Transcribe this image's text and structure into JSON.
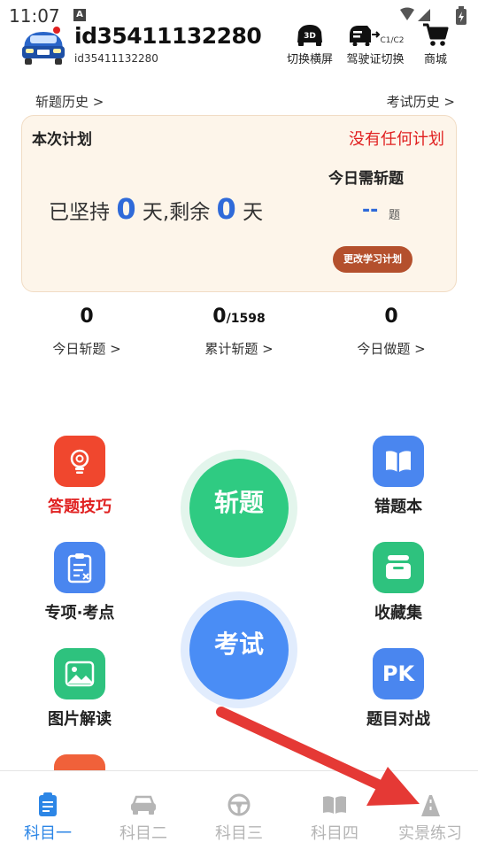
{
  "status_bar": {
    "time": "11:07",
    "badge": "A"
  },
  "user": {
    "name": "id35411132280",
    "id": "id35411132280"
  },
  "header_buttons": [
    {
      "label": "切换横屏",
      "icon": "car-3d-icon",
      "icon_text": "3D"
    },
    {
      "label": "驾驶证切换",
      "icon": "license-switch-icon",
      "icon_text": "C1/C2"
    },
    {
      "label": "商城",
      "icon": "cart-icon"
    }
  ],
  "history": {
    "left": "斩题历史 >",
    "right": "考试历史 >"
  },
  "plan": {
    "title": "本次计划",
    "status": "没有任何计划",
    "persist_prefix": "已坚持",
    "persist_days": "0",
    "persist_mid": "天,剩余",
    "remain_days": "0",
    "persist_suffix": "天",
    "need_label": "今日需斩题",
    "need_value": "--",
    "need_unit": "题",
    "change_button": "更改学习计划"
  },
  "stats": [
    {
      "value": "0",
      "suffix": "",
      "label": "今日斩题 >"
    },
    {
      "value": "0",
      "suffix": "/1598",
      "label": "累计斩题 >"
    },
    {
      "value": "0",
      "suffix": "",
      "label": "今日做题 >"
    }
  ],
  "tiles": {
    "tips": {
      "label": "答题技巧",
      "icon": "lightbulb-icon"
    },
    "wrong": {
      "label": "错题本",
      "icon": "book-icon"
    },
    "special": {
      "label": "专项·考点",
      "icon": "clipboard-icon"
    },
    "favorites": {
      "label": "收藏集",
      "icon": "box-icon"
    },
    "pictures": {
      "label": "图片解读",
      "icon": "image-icon"
    },
    "battle": {
      "label": "题目对战",
      "icon": "pk-icon",
      "icon_text": "PK"
    }
  },
  "main_buttons": {
    "practice": "斩题",
    "exam": "考试"
  },
  "colors": {
    "blue": "#2f6ad9",
    "red": "#e02020",
    "green": "#2fcb82",
    "exam_blue": "#4a8df5",
    "nav_active": "#2c86e6",
    "arrow": "#e53935"
  },
  "bottom_nav": [
    {
      "label": "科目一",
      "icon": "doc-icon",
      "active": true
    },
    {
      "label": "科目二",
      "icon": "car-icon",
      "active": false
    },
    {
      "label": "科目三",
      "icon": "steering-wheel-icon",
      "active": false
    },
    {
      "label": "科目四",
      "icon": "open-book-icon",
      "active": false
    },
    {
      "label": "实景练习",
      "icon": "road-icon",
      "active": false
    }
  ]
}
